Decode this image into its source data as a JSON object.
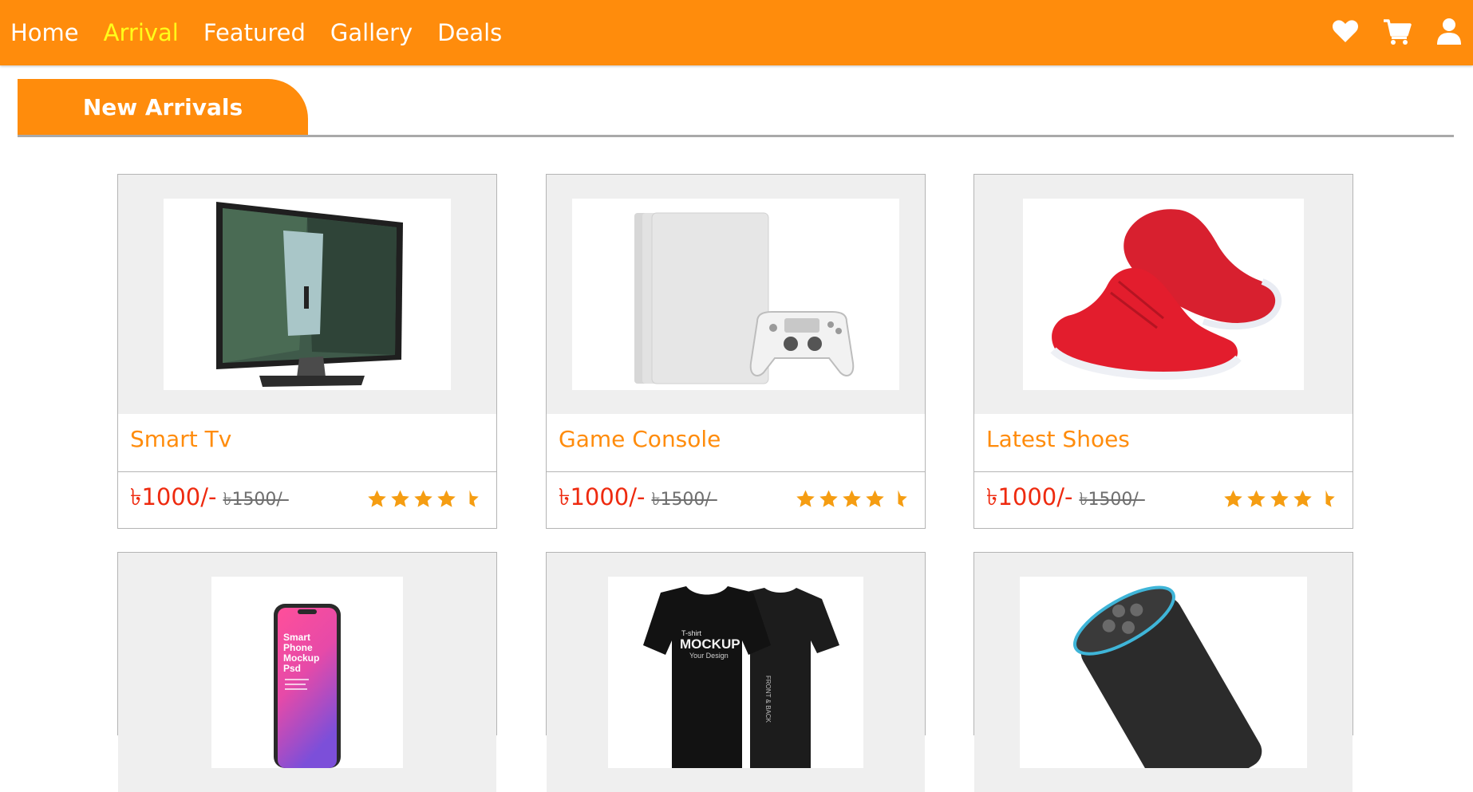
{
  "nav": {
    "links": [
      {
        "label": "Home",
        "active": false
      },
      {
        "label": "Arrival",
        "active": true
      },
      {
        "label": "Featured",
        "active": false
      },
      {
        "label": "Gallery",
        "active": false
      },
      {
        "label": "Deals",
        "active": false
      }
    ],
    "icons": [
      "heart-icon",
      "cart-icon",
      "user-icon"
    ]
  },
  "section": {
    "title": "New Arrivals"
  },
  "products": [
    {
      "name": "Smart Tv",
      "price": "৳1000/-",
      "old_price": "৳1500/-",
      "rating": 4.5,
      "image": "smart-tv-image"
    },
    {
      "name": "Game Console",
      "price": "৳1000/-",
      "old_price": "৳1500/-",
      "rating": 4.5,
      "image": "game-console-image"
    },
    {
      "name": "Latest Shoes",
      "price": "৳1000/-",
      "old_price": "৳1500/-",
      "rating": 4.5,
      "image": "shoes-image"
    },
    {
      "image": "smartphone-mockup-image",
      "image_text": [
        "Smart",
        "Phone",
        "Mockup",
        "Psd"
      ]
    },
    {
      "image": "tshirt-mockup-image",
      "image_text": [
        "T-shirt",
        "MOCKUP",
        "Your Design",
        "FRONT & BACK"
      ]
    },
    {
      "image": "smart-speaker-image"
    }
  ],
  "colors": {
    "brand": "#ff8c0c",
    "nav_active": "#ffff1a",
    "price": "#ee2a0f",
    "old_price": "#6f6f6f",
    "star": "#f59d12"
  }
}
